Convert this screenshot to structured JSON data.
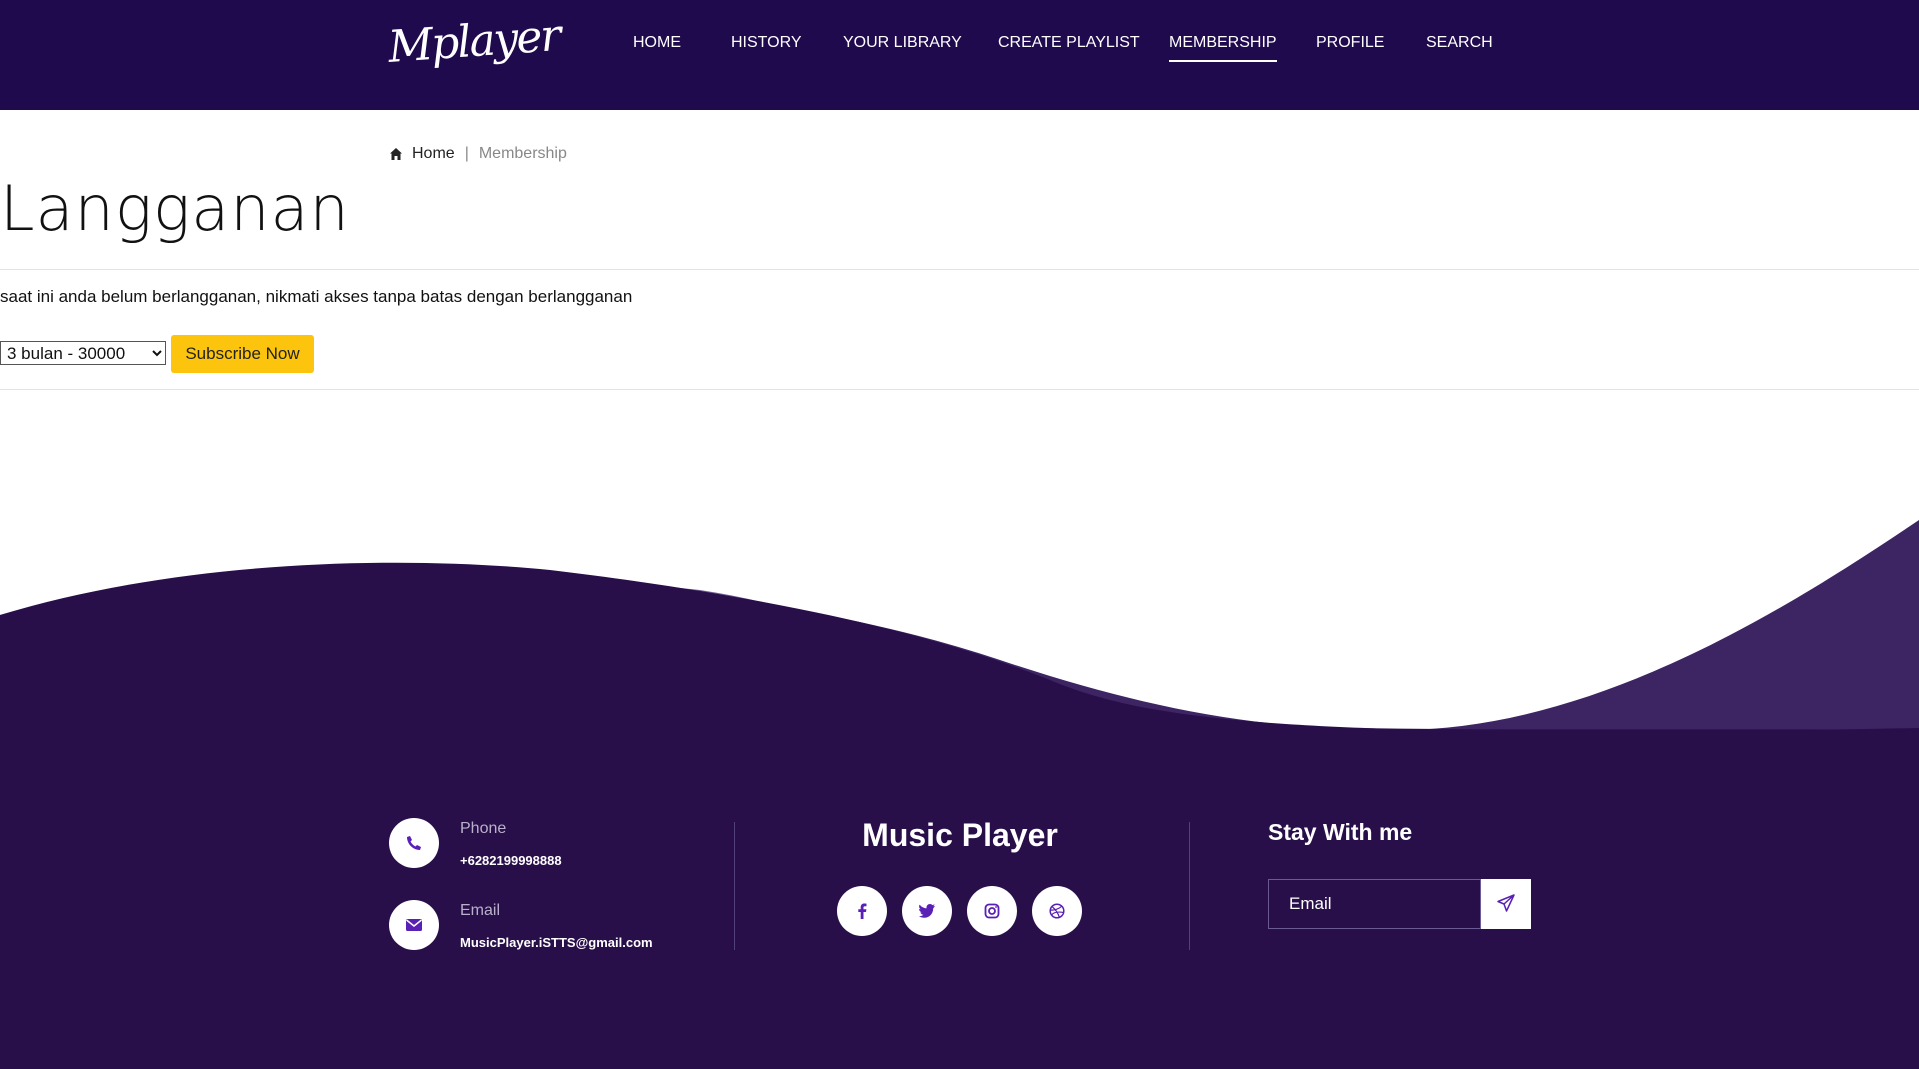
{
  "header": {
    "logo": "Mplayer",
    "nav": [
      {
        "label": "HOME"
      },
      {
        "label": "HISTORY"
      },
      {
        "label": "YOUR LIBRARY"
      },
      {
        "label": "CREATE PLAYLIST"
      },
      {
        "label": "MEMBERSHIP",
        "active": true
      },
      {
        "label": "PROFILE"
      },
      {
        "label": "SEARCH"
      }
    ]
  },
  "breadcrumb": {
    "home_icon": "home-icon",
    "home": "Home",
    "separator": "|",
    "current": "Membership"
  },
  "page": {
    "title": "Langganan",
    "message": "saat ini anda belum berlangganan, nikmati akses tanpa batas dengan berlangganan",
    "plan_select": {
      "selected": "3 bulan - 30000",
      "options": [
        "3 bulan - 30000"
      ]
    },
    "subscribe_label": "Subscribe Now"
  },
  "footer": {
    "phone": {
      "icon": "phone-icon",
      "label": "Phone",
      "value": "+6282199998888"
    },
    "email": {
      "icon": "envelope-icon",
      "label": "Email",
      "value": "MusicPlayer.iSTTS@gmail.com"
    },
    "brand": "Music Player",
    "social": [
      "facebook-icon",
      "twitter-icon",
      "instagram-icon",
      "dribbble-icon"
    ],
    "stay_title": "Stay With me",
    "newsletter_placeholder": "Email",
    "send_icon": "paper-plane-icon"
  },
  "colors": {
    "header_bg": "#200a4e",
    "footer_bg": "#290f4a",
    "wave_light": "#735d94",
    "wave_mid": "#3d2563",
    "accent_button": "#fcc40c",
    "icon_purple": "#5a1fb5"
  }
}
